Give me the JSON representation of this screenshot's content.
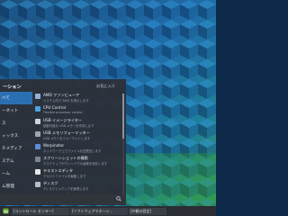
{
  "menu": {
    "title": "ーション",
    "favorites_label": "お気に入り",
    "categories": [
      {
        "label": "べて"
      },
      {
        "label": "ーネット"
      },
      {
        "label": "ス"
      },
      {
        "label": "ィックス"
      },
      {
        "label": "チメディア"
      },
      {
        "label": "ステム"
      },
      {
        "label": "ーム"
      },
      {
        "label": "ム管理"
      },
      {
        "label": "設定"
      }
    ],
    "apps": [
      {
        "name": "AMD ファンビューア",
        "desc": "システム内で AMD を表示します",
        "icon_color": "#8fb3d9",
        "icon": "amd-viewer-icon"
      },
      {
        "name": "CPU Control",
        "desc": "Flexible processor control",
        "icon_color": "#4aa3df",
        "icon": "cpu-control-icon"
      },
      {
        "name": "USB イメージライター",
        "desc": "起動可能な USB メモリを作成します",
        "icon_color": "#d0d4da",
        "icon": "usb-writer-icon"
      },
      {
        "name": "USB メモリフォーマッター",
        "desc": "USB メモリをフォーマットします",
        "icon_color": "#9ea5ae",
        "icon": "usb-formatter-icon"
      },
      {
        "name": "Warpinator",
        "desc": "ネットワーク上でファイルを送受信します",
        "icon_color": "#5b8fd6",
        "icon": "warpinator-icon"
      },
      {
        "name": "スクリーンショットの撮影",
        "desc": "デスクトップやウィンドウの画像を保存します",
        "icon_color": "#7a8896",
        "icon": "screenshot-icon"
      },
      {
        "name": "テキストエディタ",
        "desc": "テキストファイルを編集します",
        "icon_color": "#e6e6e6",
        "icon": "text-editor-icon"
      },
      {
        "name": "ディスク",
        "desc": "ディスクとメディアを管理します",
        "icon_color": "#b8bec6",
        "icon": "disks-icon"
      },
      {
        "name": "ドキュメントビューアー",
        "desc": "ドキュメントを表示します",
        "icon_color": "#c94a3a",
        "icon": "doc-viewer-icon"
      }
    ]
  },
  "taskbar": {
    "tasks": [
      {
        "label": "[コントロール センター]"
      },
      {
        "label": "[ソフトウェアマネージ..."
      },
      {
        "label": "[外観の設定]"
      }
    ]
  }
}
